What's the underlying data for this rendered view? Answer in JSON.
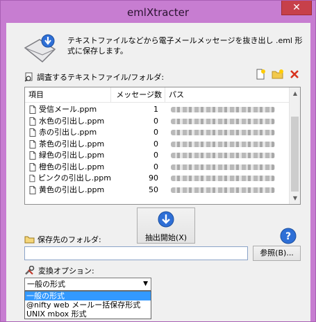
{
  "window": {
    "title": "emlXtracter",
    "close_glyph": "✕"
  },
  "description": "テキストファイルなどから電子メールメッセージを抜き出し .eml 形式に保存します。",
  "sources": {
    "label": "調査するテキストファイル/フォルダ:",
    "columns": [
      "項目",
      "メッセージ数",
      "パス"
    ],
    "rows": [
      {
        "name": "受信メール.ppm",
        "count": "1"
      },
      {
        "name": "水色の引出し.ppm",
        "count": "0"
      },
      {
        "name": "赤の引出し.ppm",
        "count": "0"
      },
      {
        "name": "茶色の引出し.ppm",
        "count": "0"
      },
      {
        "name": "緑色の引出し.ppm",
        "count": "0"
      },
      {
        "name": "橙色の引出し.ppm",
        "count": "0"
      },
      {
        "name": "ピンクの引出し.ppm",
        "count": "90"
      },
      {
        "name": "黄色の引出し.ppm",
        "count": "50"
      }
    ]
  },
  "extract_button": "抽出開始(X)",
  "destination": {
    "label": "保存先のフォルダ:",
    "value": "",
    "browse_label": "参照(B)..."
  },
  "options": {
    "label": "変換オプション:",
    "selected": "一般の形式",
    "items": [
      "一般の形式",
      "@nifty web メールー括保存形式",
      "UNIX mbox 形式"
    ]
  },
  "colors": {
    "frame": "#c77dd1",
    "accent": "#2e6fd6",
    "selection": "#3399ff"
  }
}
